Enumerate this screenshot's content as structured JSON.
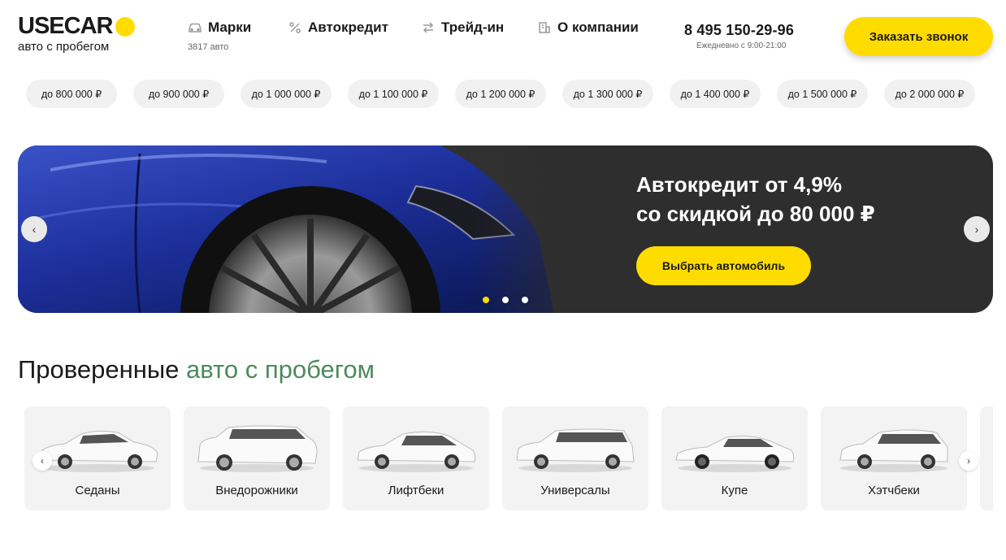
{
  "logo": {
    "name": "USECAR",
    "tagline": "авто с пробегом"
  },
  "nav": [
    {
      "label": "Марки",
      "icon": "car-icon"
    },
    {
      "label": "Автокредит",
      "icon": "percent-icon"
    },
    {
      "label": "Трейд-ин",
      "icon": "swap-arrows-icon"
    },
    {
      "label": "О компании",
      "icon": "building-icon"
    }
  ],
  "nav_count": "3817 авто",
  "contact": {
    "phone": "8 495 150-29-96",
    "hours": "Ежедневно с 9:00-21:00"
  },
  "call_button": "Заказать звонок",
  "price_chips": [
    "до 800 000 ₽",
    "до 900 000 ₽",
    "до 1 000 000 ₽",
    "до 1 100 000 ₽",
    "до 1 200 000 ₽",
    "до 1 300 000 ₽",
    "до 1 400 000 ₽",
    "до 1 500 000 ₽",
    "до 2 000 000 ₽"
  ],
  "banner": {
    "title_line1": "Автокредит от 4,9%",
    "title_line2": "со скидкой до 80 000 ₽",
    "button": "Выбрать автомобиль",
    "active_slide": 1,
    "slide_count": 3
  },
  "section": {
    "title_plain": "Проверенные",
    "title_accent": "авто с пробегом"
  },
  "body_types": [
    "Седаны",
    "Внедорожники",
    "Лифтбеки",
    "Универсалы",
    "Купе",
    "Хэтчбеки"
  ],
  "icons": {
    "prev": "‹",
    "next": "›"
  },
  "colors": {
    "accent_yellow": "#ffdc00",
    "accent_green": "#4d8a5e",
    "banner_bg": "#2e2e2e"
  }
}
